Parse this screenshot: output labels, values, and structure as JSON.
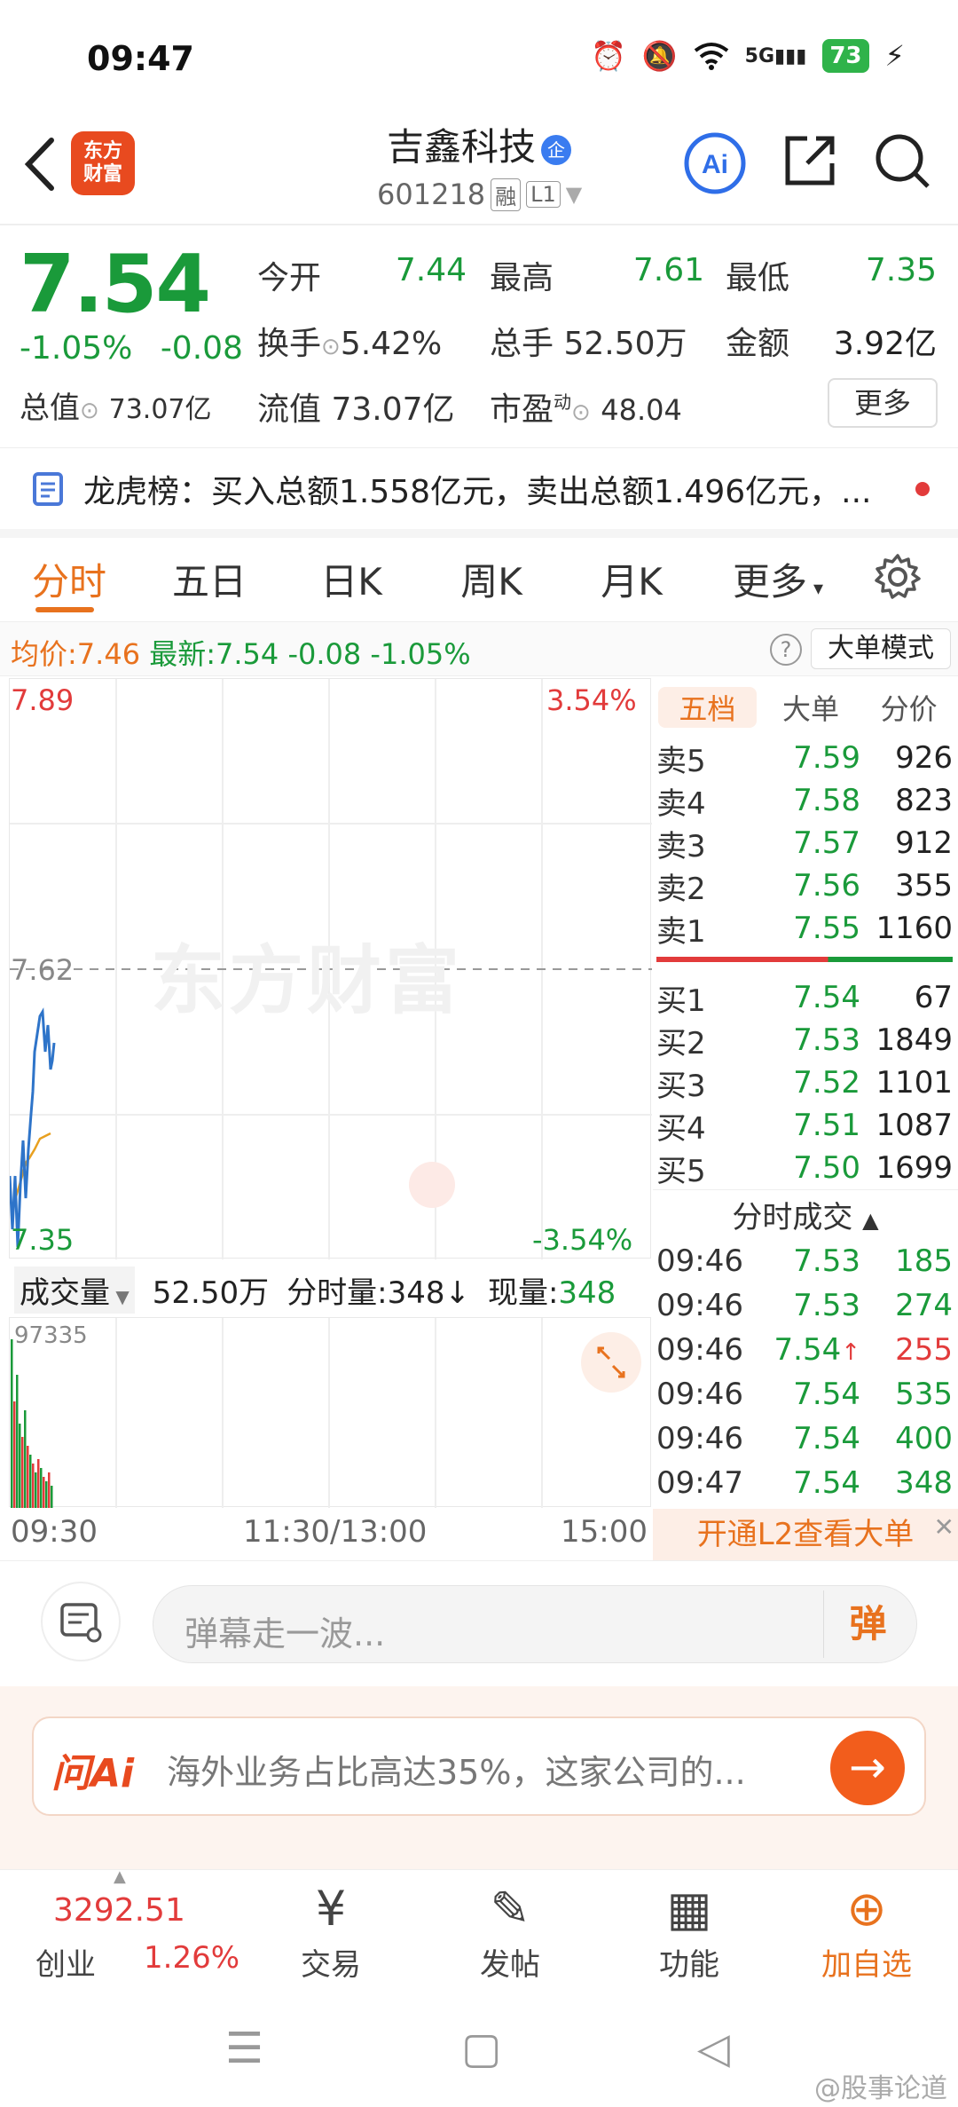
{
  "status_bar": {
    "time": "09:47",
    "signal": "5G",
    "battery": "73"
  },
  "header": {
    "logo_line1": "东方",
    "logo_line2": "财富",
    "stock_name": "吉鑫科技",
    "name_badge": "企",
    "stock_code": "601218",
    "tag_margin": "融",
    "tag_level": "L1"
  },
  "quote": {
    "price": "7.54",
    "change_pct": "-1.05%",
    "change_abs": "-0.08",
    "open_label": "今开",
    "open": "7.44",
    "high_label": "最高",
    "high": "7.61",
    "low_label": "最低",
    "low": "7.35",
    "turnover_label": "换手",
    "turnover": "5.42%",
    "volume_label": "总手",
    "volume": "52.50万",
    "amount_label": "金额",
    "amount": "3.92亿",
    "mktcap_label": "总值",
    "mktcap": "73.07亿",
    "float_label": "流值",
    "float": "73.07亿",
    "pe_label": "市盈",
    "pe_sup": "动",
    "pe": "48.04",
    "more_label": "更多"
  },
  "dragon": {
    "text": "龙虎榜：买入总额1.558亿元，卖出总额1.496亿元，..."
  },
  "tabs": [
    "分时",
    "五日",
    "日K",
    "周K",
    "月K",
    "更多"
  ],
  "avg_bar": {
    "avg_label": "均价:",
    "avg": "7.46",
    "latest_label": "最新:",
    "latest": "7.54",
    "chg": "-0.08",
    "pct": "-1.05%",
    "help": "?",
    "big_mode": "大单模式"
  },
  "chart": {
    "top_price": "7.89",
    "top_pct": "3.54%",
    "mid_price": "7.62",
    "bottom_price": "7.35",
    "bottom_pct": "-3.54%",
    "watermark": "东方财富"
  },
  "orderbook": {
    "tabs": [
      "五档",
      "大单",
      "分价"
    ],
    "asks": [
      {
        "label": "卖5",
        "price": "7.59",
        "vol": "926"
      },
      {
        "label": "卖4",
        "price": "7.58",
        "vol": "823"
      },
      {
        "label": "卖3",
        "price": "7.57",
        "vol": "912"
      },
      {
        "label": "卖2",
        "price": "7.56",
        "vol": "355"
      },
      {
        "label": "卖1",
        "price": "7.55",
        "vol": "1160"
      }
    ],
    "bids": [
      {
        "label": "买1",
        "price": "7.54",
        "vol": "67"
      },
      {
        "label": "买2",
        "price": "7.53",
        "vol": "1849"
      },
      {
        "label": "买3",
        "price": "7.52",
        "vol": "1101"
      },
      {
        "label": "买4",
        "price": "7.51",
        "vol": "1087"
      },
      {
        "label": "买5",
        "price": "7.50",
        "vol": "1699"
      }
    ]
  },
  "trades": {
    "title": "分时成交",
    "rows": [
      {
        "time": "09:46",
        "price": "7.53",
        "vol": "185",
        "dir": "sell"
      },
      {
        "time": "09:46",
        "price": "7.53",
        "vol": "274",
        "dir": "sell"
      },
      {
        "time": "09:46",
        "price": "7.54",
        "vol": "255",
        "dir": "buy",
        "arrow": "↑"
      },
      {
        "time": "09:46",
        "price": "7.54",
        "vol": "535",
        "dir": "sell"
      },
      {
        "time": "09:46",
        "price": "7.54",
        "vol": "400",
        "dir": "sell"
      },
      {
        "time": "09:47",
        "price": "7.54",
        "vol": "348",
        "dir": "sell"
      }
    ],
    "l2_promo": "开通L2查看大单"
  },
  "volume": {
    "label": "成交量",
    "total": "52.50万",
    "minute_label": "分时量:",
    "minute": "348↓",
    "now_label": "现量:",
    "now": "348",
    "max": "97335"
  },
  "time_axis": {
    "start": "09:30",
    "mid": "11:30/13:00",
    "end": "15:00"
  },
  "comment": {
    "placeholder": "弹幕走一波...",
    "dan": "弹"
  },
  "ask_ai": {
    "logo": "问Ai",
    "text": "海外业务占比高达35%，这家公司的..."
  },
  "bottom_nav": {
    "index_value": "3292.51",
    "index_name": "创业",
    "index_pct": "1.26%",
    "trade": "交易",
    "post": "发帖",
    "function": "功能",
    "watch": "加自选"
  },
  "watermark_footer": "@股事论道",
  "colors": {
    "red": "#e23b3b",
    "green": "#1a9a3a",
    "orange": "#e8721e"
  }
}
